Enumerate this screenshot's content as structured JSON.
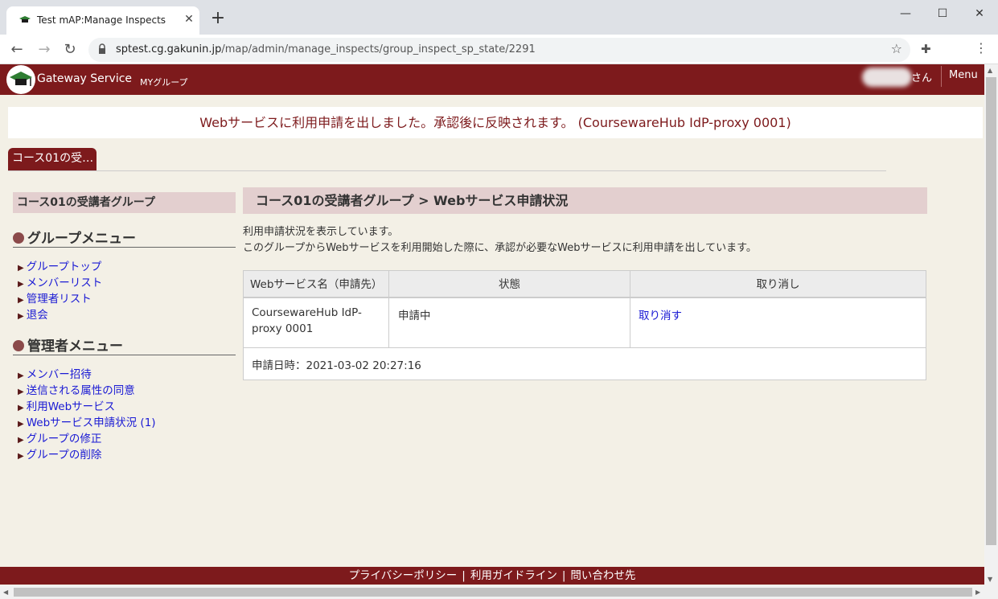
{
  "browser": {
    "tab_title": "Test mAP:Manage Inspects",
    "tab_close": "✕",
    "new_tab": "+",
    "url_host": "sptest.cg.gakunin.jp",
    "url_path": "/map/admin/manage_inspects/group_inspect_sp_state/2291",
    "minimize": "—",
    "maximize": "☐",
    "close": "✕"
  },
  "header": {
    "logo_text": "Gateway Service",
    "mygroup": "MYグループ",
    "user_suffix": "さん",
    "menu": "Menu"
  },
  "notice": "Webサービスに利用申請を出しました。承認後に反映されます。 (CoursewareHub IdP-proxy 0001)",
  "group_tab": "コース01の受…",
  "sidebar": {
    "group_name": "コース01の受講者グループ",
    "group_menu_title": "グループメニュー",
    "group_menu": [
      "グループトップ",
      "メンバーリスト",
      "管理者リスト",
      "退会"
    ],
    "admin_menu_title": "管理者メニュー",
    "admin_menu": [
      "メンバー招待",
      "送信される属性の同意",
      "利用Webサービス",
      "Webサービス申請状況 (1)",
      "グループの修正",
      "グループの削除"
    ]
  },
  "main": {
    "title": "コース01の受講者グループ > Webサービス申請状況",
    "desc1": "利用申請状況を表示しています。",
    "desc2": "このグループからWebサービスを利用開始した際に、承認が必要なWebサービスに利用申請を出しています。",
    "table": {
      "headers": [
        "Webサービス名（申請先）",
        "状態",
        "取り消し"
      ],
      "service_line1": "CoursewareHub IdP-",
      "service_line2": "proxy 0001",
      "state": "申請中",
      "cancel": "取り消す",
      "applied_at": "申請日時：2021-03-02 20:27:16"
    }
  },
  "footer": {
    "privacy": "プライバシーポリシー",
    "guide": "利用ガイドライン",
    "contact": "問い合わせ先",
    "sep": "|"
  },
  "colors": {
    "brand": "#7d1a1c",
    "accent_bg": "#e3cfcf",
    "link": "#1a1ad4"
  }
}
